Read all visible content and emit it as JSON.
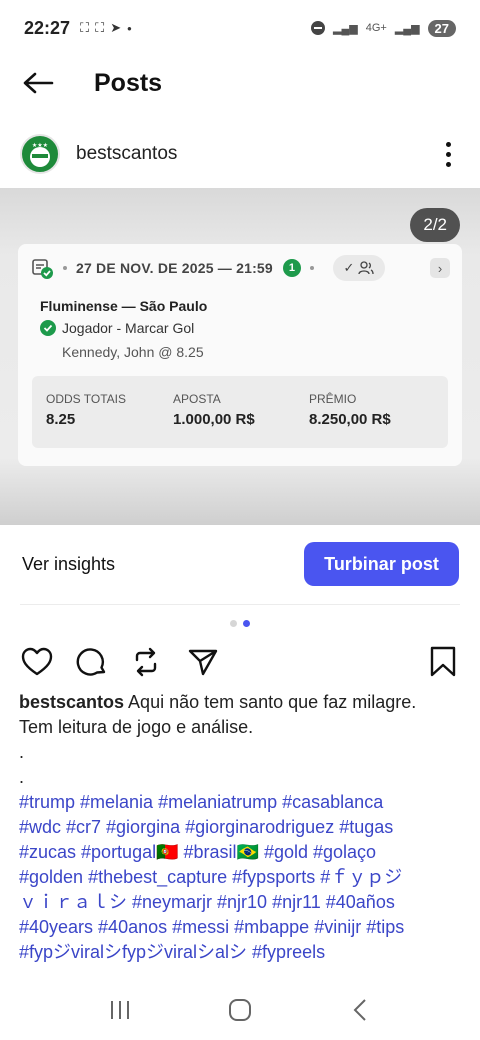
{
  "status_bar": {
    "time": "22:27",
    "network": "4G+",
    "battery": "27"
  },
  "header": {
    "title": "Posts"
  },
  "post": {
    "username": "bestscantos",
    "image_counter": "2/2",
    "bet_card": {
      "date": "27 DE NOV. DE 2025 — 21:59",
      "selections_count": "1",
      "match": "Fluminense — São Paulo",
      "market": "Jogador - Marcar Gol",
      "selection": "Kennedy, John @ 8.25",
      "totals": {
        "odds_label": "ODDS TOTAIS",
        "odds_value": "8.25",
        "stake_label": "APOSTA",
        "stake_value": "1.000,00 R$",
        "prize_label": "PRÊMIO",
        "prize_value": "8.250,00 R$"
      }
    },
    "insights_label": "Ver insights",
    "boost_label": "Turbinar post",
    "caption": {
      "username": "bestscantos",
      "line1": " Aqui não tem santo que faz milagre.",
      "line2": "Tem leitura de jogo e análise.",
      "line3": ".",
      "line4": ".",
      "hashtags": [
        "#trump #melania #melaniatrump #casablanca",
        "#wdc #cr7 #giorgina #giorginarodriguez #tugas",
        "#zucas #portugal🇵🇹 #brasil🇧🇷 #gold #golaço",
        "#golden #thebest_capture #fypsports #ｆｙｐジ",
        "ｖｉｒａｌシ #neymarjr #njr10 #njr11 #40años",
        "#40years #40anos #messi #mbappe #vinijr #tips",
        "#fypジviralシfypジviralシalシ #fypreels"
      ]
    }
  },
  "colors": {
    "accent": "#4a55f0",
    "hashtag": "#3b46c8",
    "success_green": "#1d9a4b"
  },
  "icons": {
    "back": "arrow-left-icon",
    "more": "more-vertical-icon",
    "like": "heart-icon",
    "comment": "comment-icon",
    "repost": "repost-icon",
    "share": "send-icon",
    "save": "bookmark-icon"
  }
}
